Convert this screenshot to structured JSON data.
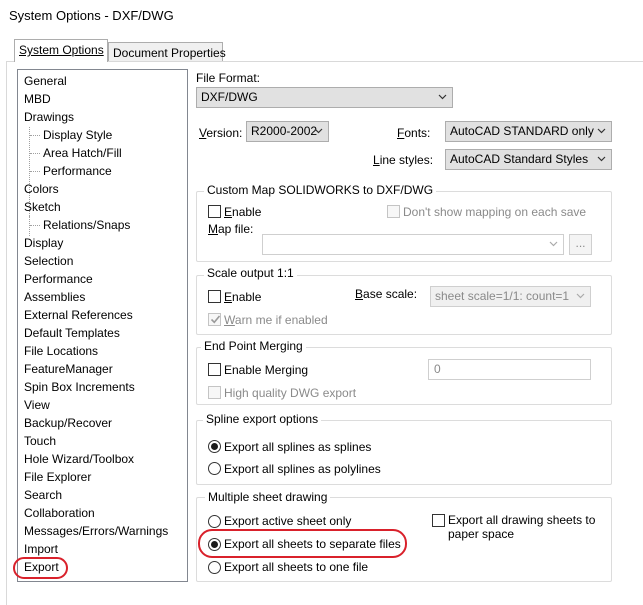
{
  "window": {
    "title": "System Options - DXF/DWG"
  },
  "tabs": [
    {
      "label": "System Options"
    },
    {
      "label": "Document Properties"
    }
  ],
  "tree": {
    "items": [
      "General",
      "MBD",
      "Drawings",
      "Display Style",
      "Area Hatch/Fill",
      "Performance",
      "Colors",
      "Sketch",
      "Relations/Snaps",
      "Display",
      "Selection",
      "Performance",
      "Assemblies",
      "External References",
      "Default Templates",
      "File Locations",
      "FeatureManager",
      "Spin Box Increments",
      "View",
      "Backup/Recover",
      "Touch",
      "Hole Wizard/Toolbox",
      "File Explorer",
      "Search",
      "Collaboration",
      "Messages/Errors/Warnings",
      "Import",
      "Export"
    ],
    "selected": "Export"
  },
  "file_format": {
    "label": "File Format:",
    "value": "DXF/DWG"
  },
  "version": {
    "label": "Version:",
    "value": "R2000-2002"
  },
  "fonts": {
    "label": "Fonts:",
    "value": "AutoCAD STANDARD only"
  },
  "line_styles": {
    "label": "Line styles:",
    "value": "AutoCAD Standard Styles"
  },
  "custom_map": {
    "title": "Custom Map SOLIDWORKS to DXF/DWG",
    "enable": "Enable",
    "dont_show": "Don't show mapping on each save",
    "map_file_label": "Map file:",
    "map_file_value": "",
    "browse": "..."
  },
  "scale_output": {
    "title": "Scale output 1:1",
    "enable": "Enable",
    "base_scale_label": "Base scale:",
    "base_scale_value": "sheet scale=1/1: count=1",
    "warn": "Warn me if enabled"
  },
  "end_point": {
    "title": "End Point Merging",
    "enable": "Enable Merging",
    "value": "0",
    "high_quality": "High quality DWG export"
  },
  "spline": {
    "title": "Spline export options",
    "options": [
      "Export all splines as splines",
      "Export all splines as polylines"
    ],
    "selected": 0
  },
  "multi_sheet": {
    "title": "Multiple sheet drawing",
    "options": [
      "Export active sheet only",
      "Export all sheets to separate files",
      "Export all sheets to one file"
    ],
    "selected": 1,
    "paper_space_line1": "Export all drawing sheets to",
    "paper_space_line2": "paper space"
  },
  "colors": {
    "highlight": "#d9212b"
  }
}
